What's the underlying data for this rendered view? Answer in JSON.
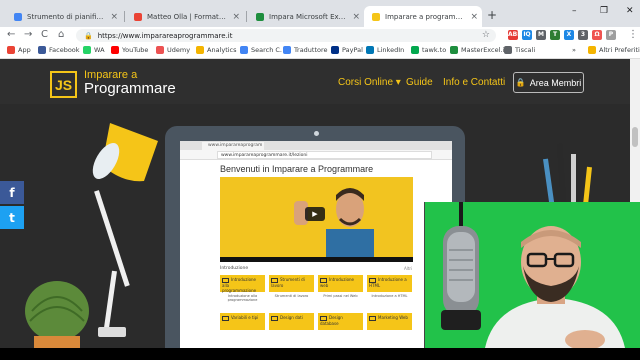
{
  "browser": {
    "tabs": [
      {
        "title": "Strumento di pianificazione defi",
        "favicon_color": "#4285f4",
        "active": false
      },
      {
        "title": "Matteo Olla | Formatore e Impr",
        "favicon_color": "#ea4335",
        "active": false
      },
      {
        "title": "Impara Microsoft Excel | Corso I",
        "favicon_color": "#1e8e3e",
        "active": false
      },
      {
        "title": "Imparare a programmare | Corso",
        "favicon_color": "#f5c518",
        "active": true
      }
    ],
    "close_glyph": "×",
    "new_tab_glyph": "+",
    "window_buttons": {
      "minimize": "–",
      "restore": "❐",
      "close": "✕"
    },
    "nav": {
      "back": "←",
      "forward": "→",
      "reload": "C",
      "home": "⌂"
    },
    "url": "https://www.imparareaprogrammare.it",
    "lock_glyph": "🔒",
    "star_glyph": "☆",
    "extensions": [
      {
        "label": "ABP",
        "color": "#e53935"
      },
      {
        "label": "IQ",
        "color": "#1e88e5"
      },
      {
        "label": "M",
        "color": "#5f6368"
      },
      {
        "label": "T",
        "color": "#2e7d32"
      },
      {
        "label": "X",
        "color": "#1e88e5"
      },
      {
        "label": "3",
        "color": "#5f6368"
      },
      {
        "label": "Ω",
        "color": "#ef5350"
      },
      {
        "label": "P",
        "color": "#9e9e9e"
      }
    ],
    "menu_glyph": "⋮"
  },
  "bookmarks": [
    {
      "label": "App",
      "color": "#ea4335"
    },
    {
      "label": "Facebook",
      "color": "#3b5998"
    },
    {
      "label": "WA",
      "color": "#25d366"
    },
    {
      "label": "YouTube",
      "color": "#ff0000"
    },
    {
      "label": "Udemy",
      "color": "#ec5252"
    },
    {
      "label": "Analytics",
      "color": "#f4b400"
    },
    {
      "label": "Search C.",
      "color": "#4285f4"
    },
    {
      "label": "Traduttore",
      "color": "#4285f4"
    },
    {
      "label": "PayPal",
      "color": "#003087"
    },
    {
      "label": "LinkedIn",
      "color": "#0077b5"
    },
    {
      "label": "tawk.to",
      "color": "#03a84e"
    },
    {
      "label": "MasterExcel.it",
      "color": "#1e8e3e"
    },
    {
      "label": "Tiscali",
      "color": "#5f6368"
    },
    {
      "label": "Altri Preferiti",
      "color": "#f4b400"
    }
  ],
  "bookmarks_more": "»",
  "site": {
    "logo_mark": "JS",
    "logo_line1": "Imparare a",
    "logo_line2": "Programmare",
    "nav": [
      {
        "label": "Corsi Online ▾"
      },
      {
        "label": "Guide"
      },
      {
        "label": "Info e Contatti"
      }
    ],
    "members_button": "Area Membri",
    "members_icon": "🔒",
    "social": [
      {
        "glyph": "f",
        "color": "#3b5998"
      },
      {
        "glyph": "t",
        "color": "#1da1f2"
      }
    ]
  },
  "inner_browser": {
    "tab_title": "www.imparareaprogram",
    "url": "www.imparareaprogrammare.it/lezioni",
    "heading": "Benvenuti in Imparare a Programmare",
    "play_glyph": "▶",
    "intro_label": "Introduzione",
    "more_label": "Altri",
    "cards": [
      {
        "label": "Introduzione alla programmazione"
      },
      {
        "label": "Strumenti di lavoro"
      },
      {
        "label": "Introduzione web"
      },
      {
        "label": "Introduzione a HTML"
      },
      {
        "label": "Variabili e tipi"
      },
      {
        "label": "Design dati"
      },
      {
        "label": "Design database"
      },
      {
        "label": "Marketing Web"
      }
    ],
    "card_captions": [
      "Introduzione alla programmazione",
      "Strumenti di lavoro",
      "Primi passi nel Web",
      "Introduzione a HTML"
    ]
  },
  "colors": {
    "accent": "#f5c518",
    "page_bg": "#2b2b2b",
    "webcam_green": "#22c24a"
  }
}
